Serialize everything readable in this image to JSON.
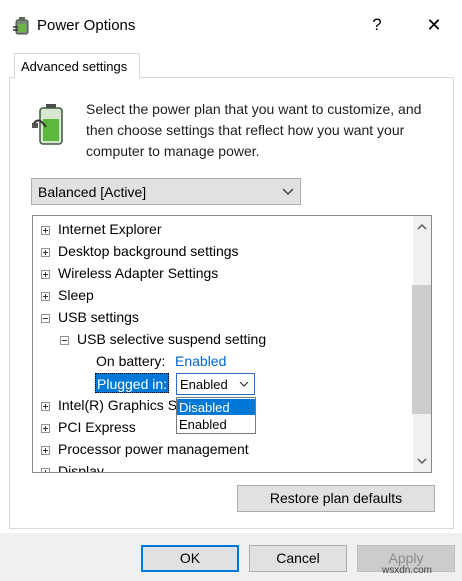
{
  "window": {
    "title": "Power Options",
    "help": "?",
    "close": "✕"
  },
  "tab": {
    "label": "Advanced settings"
  },
  "intro": {
    "text": "Select the power plan that you want to customize, and then choose settings that reflect how you want your computer to manage power."
  },
  "plan_select": {
    "value": "Balanced [Active]"
  },
  "tree": {
    "internet_explorer": "Internet Explorer",
    "desktop_background": "Desktop background settings",
    "wireless_adapter": "Wireless Adapter Settings",
    "sleep": "Sleep",
    "usb_settings": "USB settings",
    "usb_selective": "USB selective suspend setting",
    "on_battery_label": "On battery:",
    "on_battery_value": "Enabled",
    "plugged_in_label": "Plugged in:",
    "intel_graphics": "Intel(R) Graphics S",
    "pci_express": "PCI Express",
    "processor_power": "Processor power management",
    "display": "Display"
  },
  "dropdown": {
    "value": "Enabled",
    "options": [
      "Disabled",
      "Enabled"
    ],
    "highlighted": "Disabled"
  },
  "restore_button": "Restore plan defaults",
  "footer": {
    "ok": "OK",
    "cancel": "Cancel",
    "apply": "Apply"
  },
  "watermark": "wsxdn.com",
  "colors": {
    "accent": "#0078d7",
    "link": "#0066cc",
    "selection_bg": "#0078d7"
  }
}
